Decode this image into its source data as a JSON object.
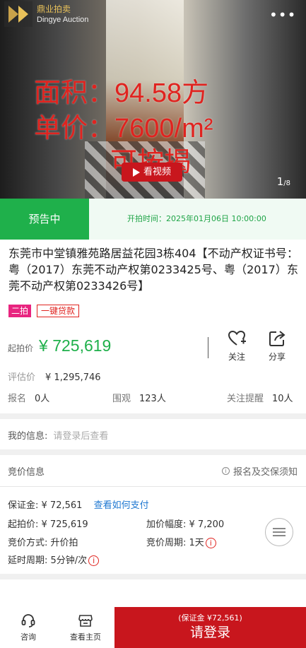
{
  "hero": {
    "logo_text": "鼎业拍卖",
    "logo_sub": "Dingye Auction",
    "more_label": "•••",
    "overlay_area": "面积：94.58方",
    "overlay_price": "单价：7600/m²",
    "overlay_mortgage": "可按揭",
    "video_label": "看视频",
    "pager_current": "1",
    "pager_total": "/8"
  },
  "status": {
    "tag": "预告中",
    "time_label": "开拍时间：2025年01月06日 10:00:00"
  },
  "title": "东莞市中堂镇雅苑路居益花园3栋404【不动产权证书号：粤（2017）东莞不动产权第0233425号、粤（2017）东莞不动产权第0233426号】",
  "badges": {
    "b1": "二拍",
    "b2": "一键贷款"
  },
  "price": {
    "label": "起拍价",
    "value": "¥ 725,619"
  },
  "actions": {
    "follow": "关注",
    "share": "分享"
  },
  "evaluation": {
    "label": "评估价",
    "value": "¥ 1,295,746"
  },
  "stats": {
    "signup_label": "报名",
    "signup_value": "0人",
    "watch_label": "围观",
    "watch_value": "123人",
    "remind_label": "关注提醒",
    "remind_value": "10人"
  },
  "my_info": {
    "label": "我的信息:",
    "hint": "请登录后查看"
  },
  "bid_info": {
    "header": "竞价信息",
    "notice": "报名及交保须知",
    "deposit_label": "保证金:",
    "deposit_value": "¥ 72,561",
    "pay_link": "查看如何支付",
    "start_label": "起拍价:",
    "start_value": "¥ 725,619",
    "increment_label": "加价幅度:",
    "increment_value": "¥ 7,200",
    "method_label": "竞价方式:",
    "method_value": "升价拍",
    "period_label": "竞价周期:",
    "period_value": "1天",
    "delay_label": "延时周期:",
    "delay_value": "5分钟/次"
  },
  "bottom": {
    "consult": "咨询",
    "homepage": "查看主页",
    "login_sub": "(保证金 ¥72,561)",
    "login_main": "请登录"
  },
  "colors": {
    "green": "#1fb04b",
    "red": "#c8161d",
    "link": "#1f78d1"
  }
}
